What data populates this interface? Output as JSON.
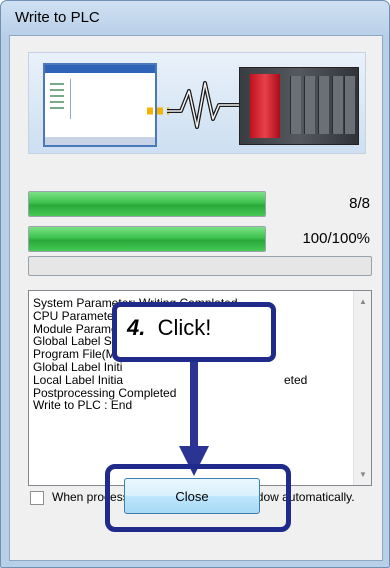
{
  "window": {
    "title": "Write to PLC"
  },
  "progress": [
    {
      "label": "8/8",
      "fraction": 1.0
    },
    {
      "label": "100/100%",
      "fraction": 1.0
    },
    {
      "fraction": 0.0
    }
  ],
  "log_lines": [
    "System Parameter: Writing Completed",
    "CPU Parameter: Writing Completed",
    "Module Parameter: Writing Completed",
    "Global Label Set",
    "Program File(MA",
    "Global Label Initi",
    "Local Label Initia",
    "Postprocessing Completed",
    "Write to PLC : End"
  ],
  "log_line7_tail": "eted",
  "callout": {
    "step": "4.",
    "text": "Click!"
  },
  "checkbox": {
    "label_left": "When processing ends, c",
    "label_right": "se this window automatically.",
    "checked": false
  },
  "close_button": {
    "label": "Close"
  },
  "colors": {
    "accent": "#1f2a8a",
    "progress_green": "#3dc24d"
  },
  "icons": [
    "pc-software-icon",
    "serial-cable-icon",
    "plc-hardware-icon",
    "scroll-up-icon",
    "scroll-down-icon"
  ]
}
